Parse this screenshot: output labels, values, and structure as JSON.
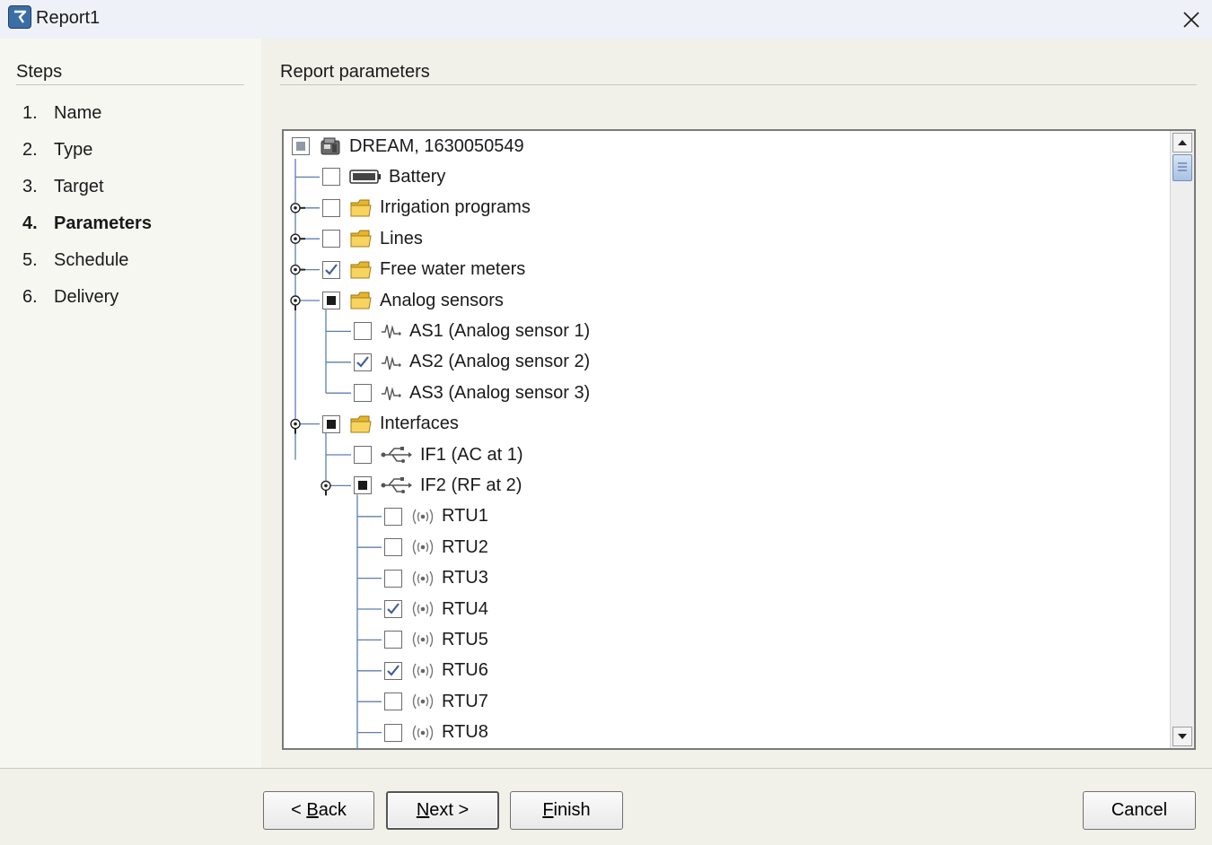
{
  "window": {
    "title": "Report1"
  },
  "steps": {
    "heading": "Steps",
    "items": [
      {
        "num": "1.",
        "label": "Name",
        "active": false
      },
      {
        "num": "2.",
        "label": "Type",
        "active": false
      },
      {
        "num": "3.",
        "label": "Target",
        "active": false
      },
      {
        "num": "4.",
        "label": "Parameters",
        "active": true
      },
      {
        "num": "5.",
        "label": "Schedule",
        "active": false
      },
      {
        "num": "6.",
        "label": "Delivery",
        "active": false
      }
    ]
  },
  "main": {
    "heading": "Report parameters",
    "tree": [
      {
        "label": "DREAM, 1630050549",
        "icon": "device-icon",
        "state": "partial-gray",
        "level": 0
      },
      {
        "label": "Battery",
        "icon": "battery-icon",
        "state": "unchecked",
        "level": 1
      },
      {
        "label": "Irrigation programs",
        "icon": "folder-icon",
        "state": "unchecked",
        "level": 1,
        "expandable": true
      },
      {
        "label": "Lines",
        "icon": "folder-icon",
        "state": "unchecked",
        "level": 1,
        "expandable": true
      },
      {
        "label": "Free water meters",
        "icon": "folder-icon",
        "state": "checked",
        "level": 1,
        "expandable": true
      },
      {
        "label": "Analog sensors",
        "icon": "folder-icon",
        "state": "partial",
        "level": 1,
        "expanded": true
      },
      {
        "label": "AS1 (Analog sensor 1)",
        "icon": "pulse-icon",
        "state": "unchecked",
        "level": 2
      },
      {
        "label": "AS2 (Analog sensor 2)",
        "icon": "pulse-icon",
        "state": "checked",
        "level": 2
      },
      {
        "label": "AS3 (Analog sensor 3)",
        "icon": "pulse-icon",
        "state": "unchecked",
        "level": 2
      },
      {
        "label": "Interfaces",
        "icon": "folder-icon",
        "state": "partial",
        "level": 1,
        "expanded": true
      },
      {
        "label": "IF1 (AC at 1)",
        "icon": "usb-icon",
        "state": "unchecked",
        "level": 2
      },
      {
        "label": "IF2 (RF at 2)",
        "icon": "usb-icon",
        "state": "partial",
        "level": 2,
        "expanded": true
      },
      {
        "label": "RTU1",
        "icon": "radio-icon",
        "state": "unchecked",
        "level": 3
      },
      {
        "label": "RTU2",
        "icon": "radio-icon",
        "state": "unchecked",
        "level": 3
      },
      {
        "label": "RTU3",
        "icon": "radio-icon",
        "state": "unchecked",
        "level": 3
      },
      {
        "label": "RTU4",
        "icon": "radio-icon",
        "state": "checked",
        "level": 3
      },
      {
        "label": "RTU5",
        "icon": "radio-icon",
        "state": "unchecked",
        "level": 3
      },
      {
        "label": "RTU6",
        "icon": "radio-icon",
        "state": "checked",
        "level": 3
      },
      {
        "label": "RTU7",
        "icon": "radio-icon",
        "state": "unchecked",
        "level": 3
      },
      {
        "label": "RTU8",
        "icon": "radio-icon",
        "state": "unchecked",
        "level": 3
      }
    ]
  },
  "buttons": {
    "back": {
      "pre": "< ",
      "mnemonic": "B",
      "rest": "ack"
    },
    "next": {
      "pre": "",
      "mnemonic": "N",
      "rest": "ext >"
    },
    "finish": {
      "pre": "",
      "mnemonic": "F",
      "rest": "inish"
    },
    "cancel": "Cancel"
  },
  "colors": {
    "titlebar": "#eef1f7",
    "check": "#3f5f9a",
    "folder": "#f0c43e"
  }
}
